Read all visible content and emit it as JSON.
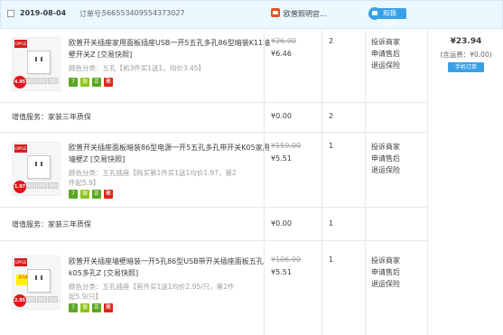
{
  "order": {
    "date": "2019-08-04",
    "order_no_label": "订单号:",
    "order_no": "566553409554373027",
    "shop_name": "欧普照明官...",
    "chat_label": "和我联系",
    "total": "¥23.94",
    "shipping": "(含运费：¥0.00)",
    "mobile_order_label": "手机订单"
  },
  "items": [
    {
      "title": "欧普开关插座家用面板插座USB一开5五孔多孔86型暗装K11墙壁开关Z [交易快照]",
      "spec": "颜色分类：五孔【前3件买1送1，均价3.45】",
      "orig_price": "¥26.90",
      "price": "¥6.46",
      "qty": "2",
      "thumb_tag": "4.95",
      "ops": [
        "投诉商家",
        "申请售后",
        "退运保险"
      ]
    },
    {
      "title": "欧普开关插座面板暗装86型电源一开5五孔多孔带开关K05家用墙壁Z [交易快照]",
      "spec": "颜色分类：五孔插座【购买第1件买1送1均价1.97，第2件起5.9】",
      "orig_price": "¥159.00",
      "price": "¥5.51",
      "qty": "1",
      "thumb_tag": "1.97",
      "ops": [
        "投诉商家",
        "申请售后",
        "退运保险"
      ]
    },
    {
      "title": "欧普开关插座墙壁暗装一开5孔86型USB带开关插座面板五孔k05多孔Z [交易快照]",
      "spec": "颜色分类：五孔插座【首件买1送1均价2.95/只，第2件起5.9/只】",
      "orig_price": "¥106.00",
      "price": "¥5.51",
      "qty": "1",
      "thumb_tag": "2.95",
      "ops": [
        "投诉商家",
        "申请售后",
        "退运保险"
      ]
    }
  ],
  "services": [
    {
      "label": "增值服务：家装三年质保",
      "price": "¥0.00",
      "qty": "2"
    },
    {
      "label": "增值服务：家装三年质保",
      "price": "¥0.00",
      "qty": "1"
    }
  ],
  "badges": [
    "7",
    "保",
    "正",
    "聚"
  ],
  "thumb_logo": "OPPLE",
  "thumb_ribbon": "买1送1",
  "colors": {
    "header_bg": "#eaf8ff",
    "accent": "#3aa0e6",
    "brand_red": "#e5511d"
  }
}
